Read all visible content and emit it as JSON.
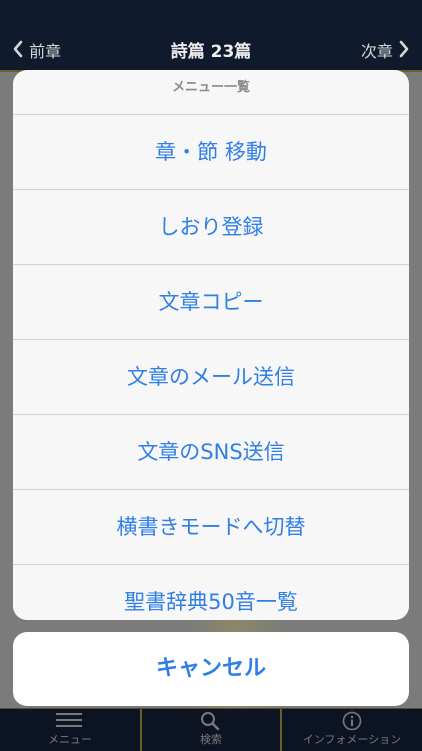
{
  "nav": {
    "prev_label": "前章",
    "title": "詩篇 23篇",
    "next_label": "次章"
  },
  "sheet": {
    "title": "メニュー一覧",
    "items": [
      {
        "label": "章・節 移動"
      },
      {
        "label": "しおり登録"
      },
      {
        "label": "文章コピー"
      },
      {
        "label": "文章のメール送信"
      },
      {
        "label": "文章のSNS送信"
      },
      {
        "label": "横書きモードへ切替"
      },
      {
        "label": "聖書辞典50音一覧"
      }
    ],
    "cancel_label": "キャンセル"
  },
  "tabbar": {
    "tabs": [
      {
        "label": "メニュー",
        "icon": "hamburger-icon"
      },
      {
        "label": "検索",
        "icon": "search-icon"
      },
      {
        "label": "インフォメーション",
        "icon": "info-icon"
      }
    ]
  },
  "colors": {
    "accent": "#2f7fe6",
    "nav_bg": "#0f1a2c",
    "gold_border": "#6d5d2a"
  }
}
